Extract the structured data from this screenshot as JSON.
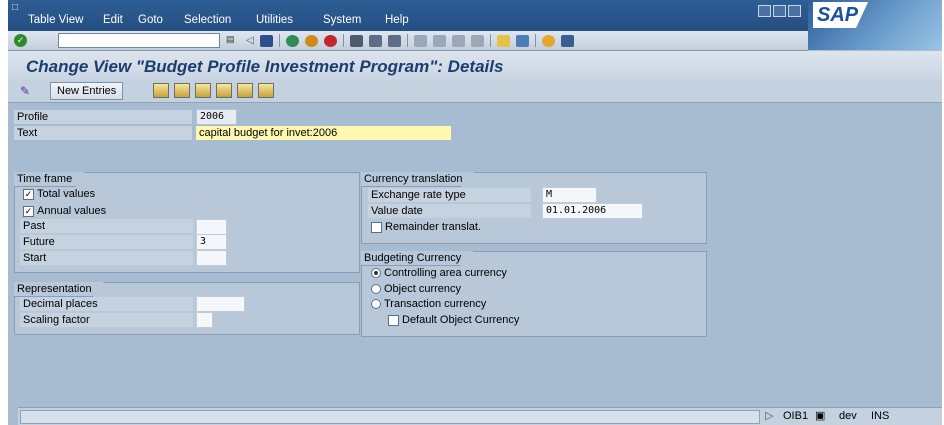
{
  "menu": {
    "items": [
      "Table View",
      "Edit",
      "Goto",
      "Selection",
      "Utilities",
      "System",
      "Help"
    ],
    "logo": "SAP"
  },
  "title": "Change View \"Budget Profile Investment Program\": Details",
  "app_toolbar": {
    "new_entries": "New Entries"
  },
  "header": {
    "profile_label": "Profile",
    "profile_value": "2006",
    "text_label": "Text",
    "text_value": "capital budget for invet:2006"
  },
  "time_frame": {
    "title": "Time frame",
    "total_values": "Total values",
    "total_values_checked": true,
    "annual_values": "Annual values",
    "annual_values_checked": true,
    "past_label": "Past",
    "past_value": "",
    "future_label": "Future",
    "future_value": "3",
    "start_label": "Start",
    "start_value": ""
  },
  "representation": {
    "title": "Representation",
    "decimal_label": "Decimal places",
    "decimal_value": "",
    "scaling_label": "Scaling factor",
    "scaling_value": ""
  },
  "currency_translation": {
    "title": "Currency translation",
    "rate_type_label": "Exchange rate type",
    "rate_type_value": "M",
    "value_date_label": "Value date",
    "value_date_value": "01.01.2006",
    "remainder_label": "Remainder translat.",
    "remainder_checked": false
  },
  "budgeting_currency": {
    "title": "Budgeting Currency",
    "options": [
      "Controlling area currency",
      "Object currency",
      "Transaction currency"
    ],
    "selected": "Controlling area currency",
    "default_obj_label": "Default Object Currency",
    "default_obj_checked": false
  },
  "status": {
    "transaction": "OIB1",
    "system": "dev",
    "mode": "INS"
  }
}
